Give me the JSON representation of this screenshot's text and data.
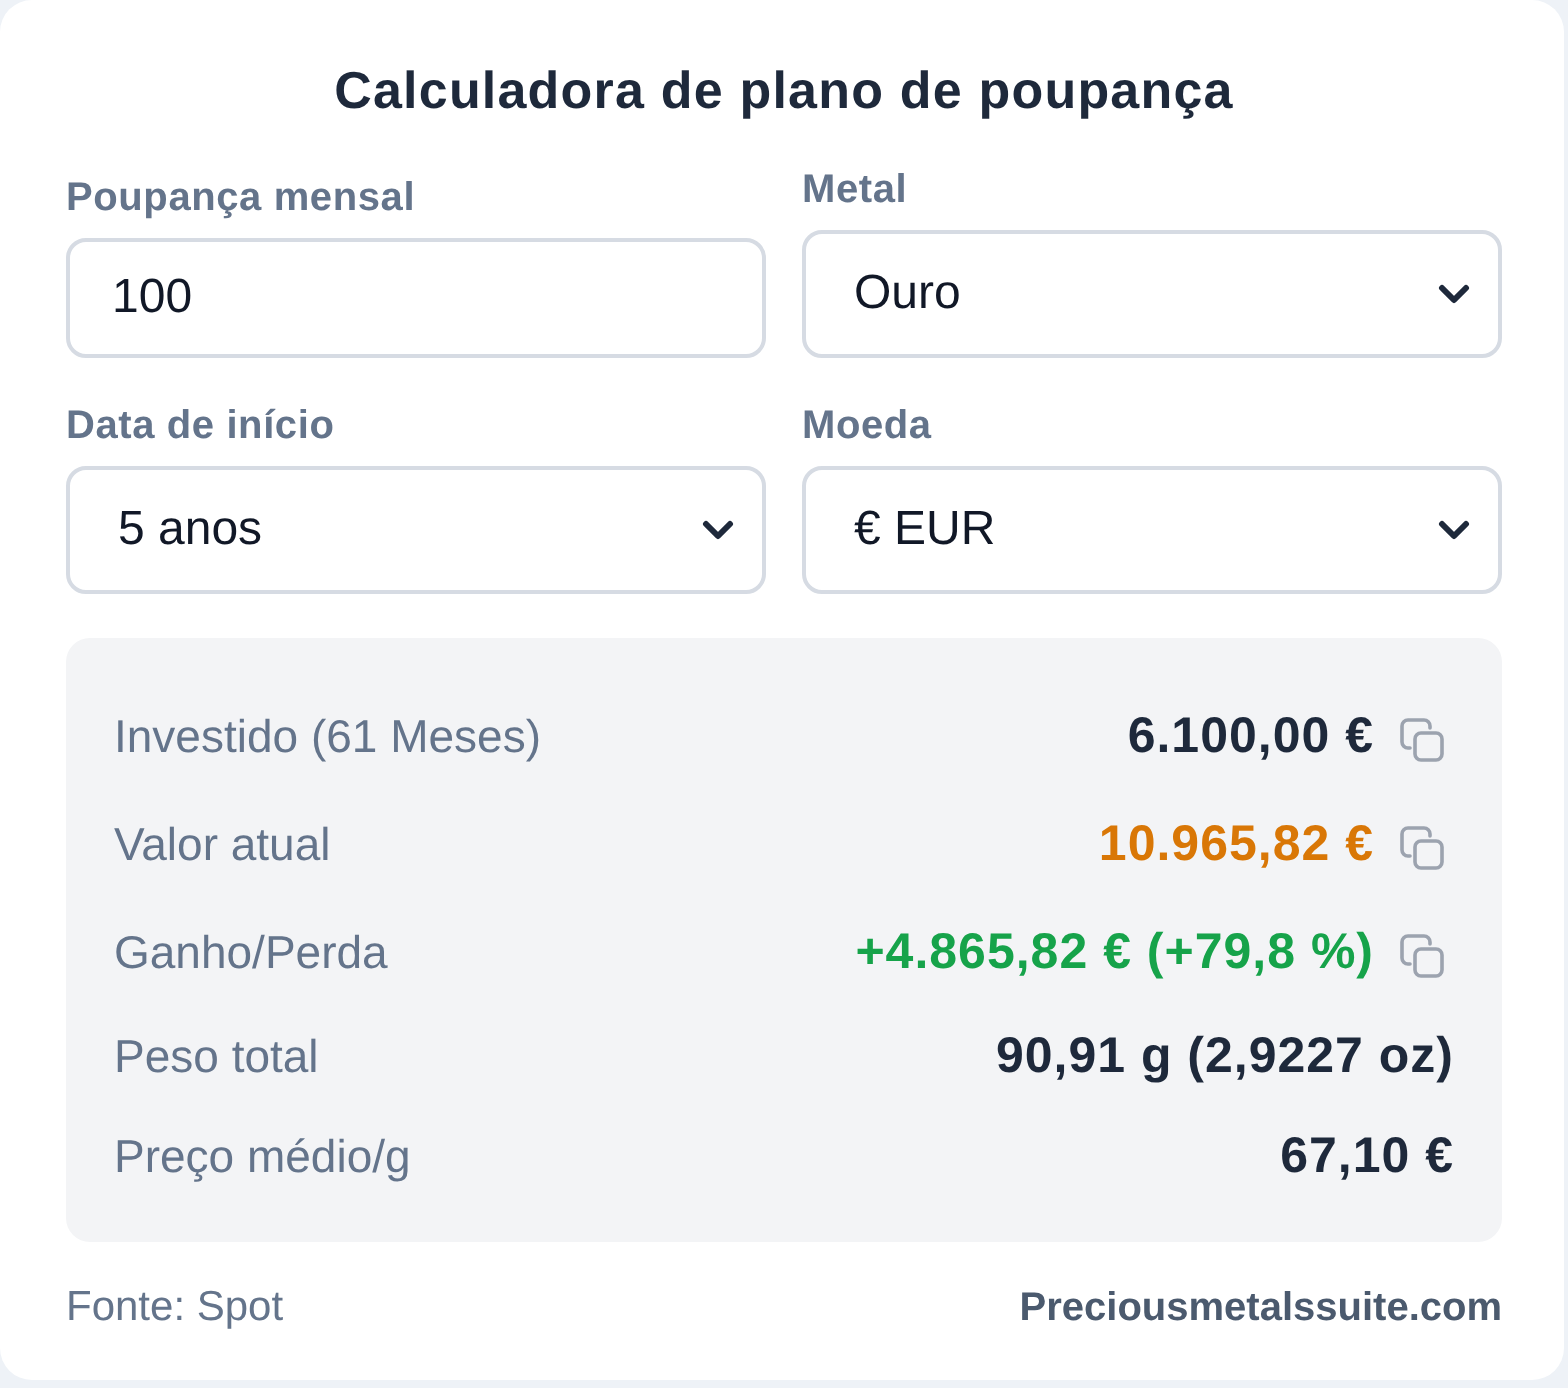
{
  "title": "Calculadora de plano de poupança",
  "fields": [
    {
      "kind": "input",
      "label": "Poupança mensal",
      "value": "100"
    },
    {
      "kind": "select",
      "label": "Metal",
      "value": "Ouro"
    },
    {
      "kind": "select",
      "label": "Data de início",
      "value": "5 anos"
    },
    {
      "kind": "select",
      "label": "Moeda",
      "value": "€ EUR"
    }
  ],
  "results": [
    {
      "label": "Investido (61 Meses)",
      "value": "6.100,00 €",
      "color": "#1e293b",
      "copyable": true
    },
    {
      "label": "Valor atual",
      "value": "10.965,82 €",
      "color": "#d97706",
      "copyable": true
    },
    {
      "label": "Ganho/Perda",
      "value": "+4.865,82 € (+79,8 %)",
      "color": "#16a34a",
      "copyable": true
    },
    {
      "label": "Peso total",
      "value": "90,91 g (2,9227 oz)",
      "color": "#1e293b",
      "copyable": false
    },
    {
      "label": "Preço médio/g",
      "value": "67,10 €",
      "color": "#1e293b",
      "copyable": false
    }
  ],
  "footer": {
    "source": "Fonte: Spot",
    "site": "Preciousmetalssuite.com"
  }
}
